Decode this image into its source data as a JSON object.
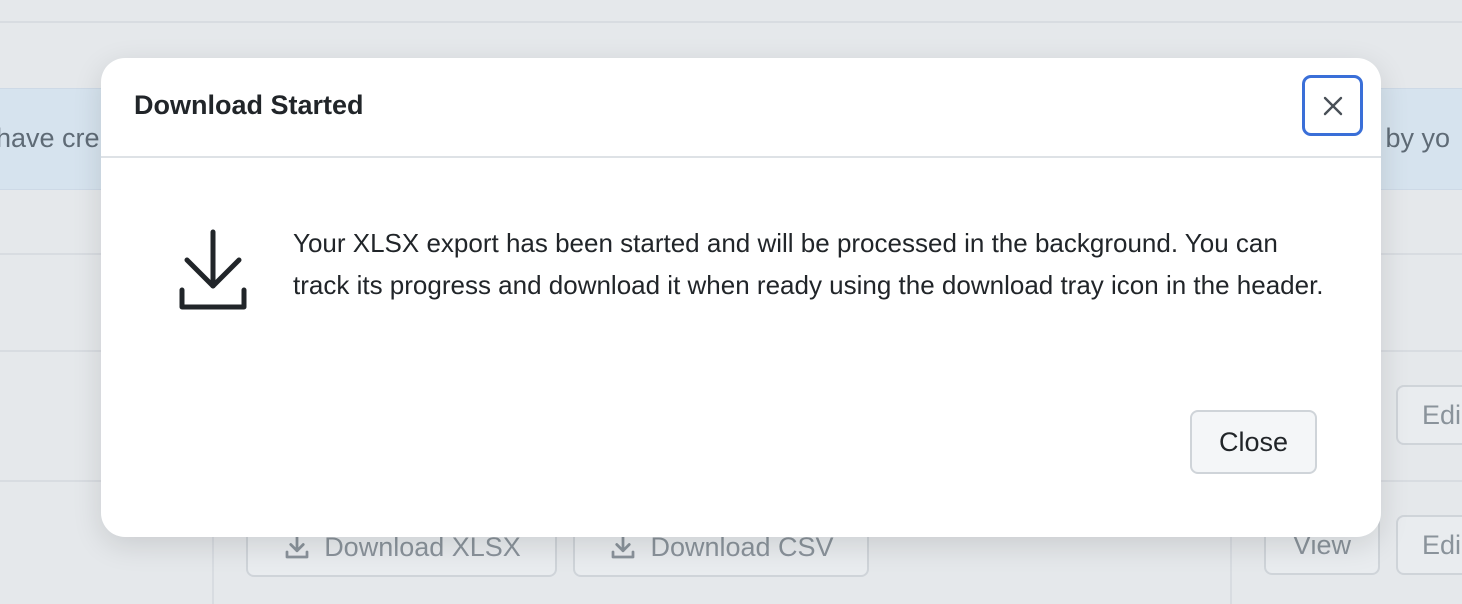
{
  "background": {
    "info_left_text": "have cre",
    "info_right_text": "l by yo",
    "buttons": {
      "download_xlsx": "Download XLSX",
      "download_csv": "Download CSV",
      "view": "View",
      "edit_1": "Edi",
      "edit_2": "Edi"
    }
  },
  "modal": {
    "title": "Download Started",
    "message": "Your XLSX export has been started and will be processed in the background. You can track its progress and download it when ready using the download tray icon in the header.",
    "close_button_label": "Close",
    "icon": "download-icon"
  },
  "colors": {
    "focus_ring": "#3a6fd8",
    "overlay_bg": "#e5e8eb",
    "info_bg": "#d6e3ee",
    "text": "#212529"
  }
}
